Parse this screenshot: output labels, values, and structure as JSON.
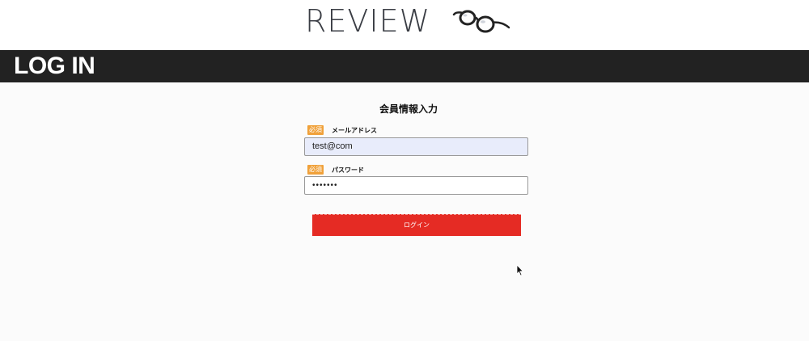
{
  "header": {
    "logo_text": "REVIEW",
    "logo_icon": "glasses-icon"
  },
  "title_bar": {
    "title": "LOG IN"
  },
  "form": {
    "heading": "会員情報入力",
    "required_badge": "必須",
    "email": {
      "label": "メールアドレス",
      "value": "test@com"
    },
    "password": {
      "label": "パスワード",
      "value": "•••••••"
    },
    "submit_label": "ログイン"
  },
  "colors": {
    "title_bar_bg": "#222222",
    "badge": "#f0a13a",
    "button": "#e52b24",
    "autofill_bg": "#e8ecfb"
  }
}
